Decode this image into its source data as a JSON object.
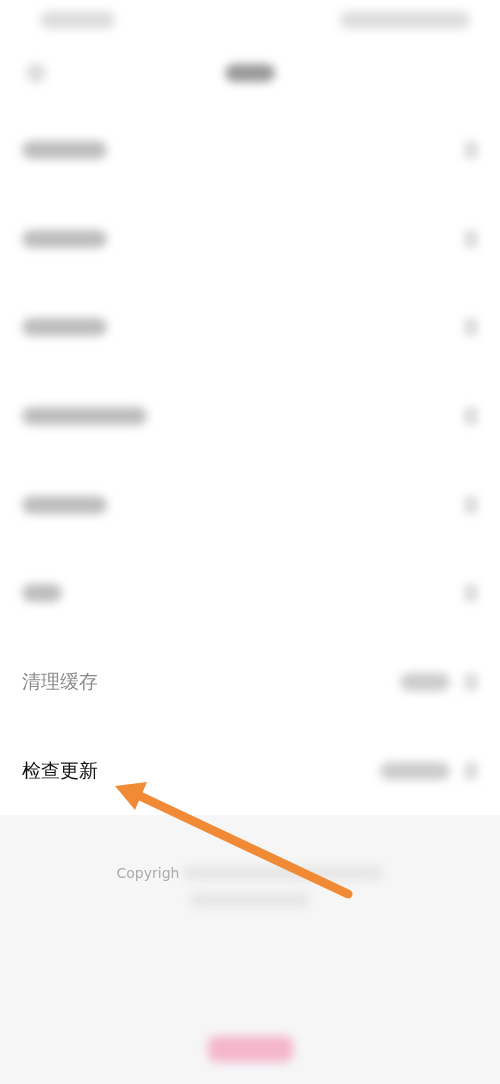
{
  "rows": [
    {
      "kind": "blurred"
    },
    {
      "kind": "blurred"
    },
    {
      "kind": "blurred"
    },
    {
      "kind": "blurred"
    },
    {
      "kind": "blurred"
    },
    {
      "kind": "blurred"
    },
    {
      "kind": "faded",
      "label": "清理缓存"
    },
    {
      "kind": "plain",
      "label": "检查更新"
    }
  ],
  "footer": {
    "copyright": "Copyrigh"
  }
}
